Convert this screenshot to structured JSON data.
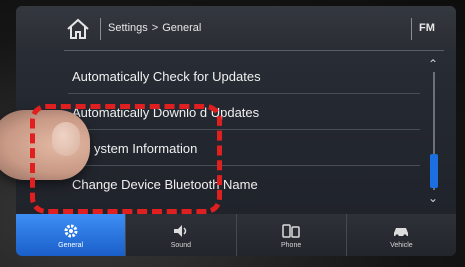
{
  "header": {
    "home_icon": "home-icon",
    "crumb_parent": "Settings",
    "crumb_separator": ">",
    "crumb_current": "General",
    "source": "FM"
  },
  "list": {
    "items": [
      {
        "label": "Automatically Check for Updates"
      },
      {
        "label": "Automatically Downlo d Updates"
      },
      {
        "label": "ystem Information"
      },
      {
        "label": "Change Device Bluetooth Name"
      }
    ]
  },
  "tabs": [
    {
      "label": "General",
      "icon": "gear-icon",
      "active": true
    },
    {
      "label": "Sound",
      "icon": "speaker-icon",
      "active": false
    },
    {
      "label": "Phone",
      "icon": "phone-icon",
      "active": false
    },
    {
      "label": "Vehicle",
      "icon": "car-icon",
      "active": false
    }
  ],
  "colors": {
    "annotation": "#e02020",
    "active_tab": "#1a5fc9",
    "scroll_thumb": "#1c6fe0"
  }
}
